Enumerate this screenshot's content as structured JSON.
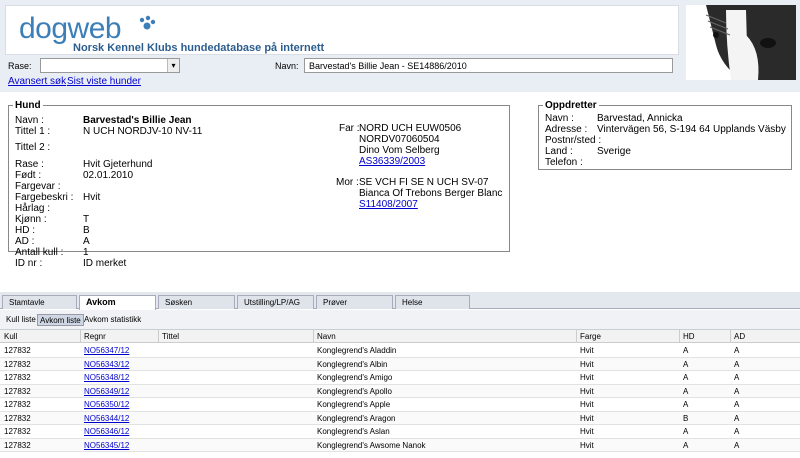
{
  "header": {
    "logo_text": "dogweb",
    "subtitle": "Norsk Kennel Klubs hundedatabase på internett"
  },
  "search": {
    "rase_label": "Rase:",
    "rase_value": "",
    "navn_label": "Navn:",
    "navn_value": "Barvestad's Billie Jean - SE14886/2010",
    "avansert_link": "Avansert søk",
    "sist_link": "Sist viste hunder"
  },
  "hund": {
    "legend": "Hund",
    "fields": [
      {
        "label": "Navn :",
        "value": "Barvestad's Billie Jean"
      },
      {
        "label": "Tittel 1 :",
        "value": "N UCH NORDJV-10 NV-11"
      },
      {
        "label": "Tittel 2 :",
        "value": ""
      },
      {
        "label": "Rase :",
        "value": "Hvit Gjeterhund"
      },
      {
        "label": "Født :",
        "value": "02.01.2010"
      },
      {
        "label": "Fargevar :",
        "value": ""
      },
      {
        "label": "Fargebeskri :",
        "value": "Hvit"
      },
      {
        "label": "Hårlag :",
        "value": ""
      },
      {
        "label": "Kjønn :",
        "value": "T"
      },
      {
        "label": "HD :",
        "value": "B"
      },
      {
        "label": "AD :",
        "value": "A"
      },
      {
        "label": "Antall kull :",
        "value": "1"
      },
      {
        "label": "ID nr :",
        "value": "ID merket"
      }
    ],
    "far": {
      "label": "Far :",
      "titles": "NORD UCH EUW0506",
      "titles2": "NORDV07060504",
      "name": "Dino Vom Selberg",
      "regnr": "AS36339/2003"
    },
    "mor": {
      "label": "Mor :",
      "titles": "SE VCH FI SE N UCH SV-07",
      "name": "Bianca Of Trebons Berger Blanc",
      "regnr": "S11408/2007"
    }
  },
  "oppdretter": {
    "legend": "Oppdretter",
    "fields": [
      {
        "label": "Navn :",
        "value": "Barvestad, Annicka"
      },
      {
        "label": "Adresse :",
        "value": "Vintervägen 56, S-194 64 Upplands Väsby"
      },
      {
        "label": "Postnr/sted :",
        "value": ""
      },
      {
        "label": "Land :",
        "value": "Sverige"
      },
      {
        "label": "Telefon :",
        "value": ""
      }
    ]
  },
  "tabs": [
    "Stamtavle",
    "Avkom",
    "Søsken",
    "Utstilling/LP/AG",
    "Prøver",
    "Helse"
  ],
  "active_tab": "Avkom",
  "subtabs": [
    "Kull liste",
    "Avkom liste",
    "Avkom statistikk"
  ],
  "active_subtab": "Avkom liste",
  "table": {
    "columns": [
      "Kull",
      "Regnr",
      "Tittel",
      "Navn",
      "Farge",
      "HD",
      "AD"
    ],
    "rows": [
      {
        "kull": "127832",
        "regnr": "NO56347/12",
        "tittel": "",
        "navn": "Konglegrend's Aladdin",
        "farge": "Hvit",
        "hd": "A",
        "ad": "A"
      },
      {
        "kull": "127832",
        "regnr": "NO56343/12",
        "tittel": "",
        "navn": "Konglegrend's Albin",
        "farge": "Hvit",
        "hd": "A",
        "ad": "A"
      },
      {
        "kull": "127832",
        "regnr": "NO56348/12",
        "tittel": "",
        "navn": "Konglegrend's Amigo",
        "farge": "Hvit",
        "hd": "A",
        "ad": "A"
      },
      {
        "kull": "127832",
        "regnr": "NO56349/12",
        "tittel": "",
        "navn": "Konglegrend's Apollo",
        "farge": "Hvit",
        "hd": "A",
        "ad": "A"
      },
      {
        "kull": "127832",
        "regnr": "NO56350/12",
        "tittel": "",
        "navn": "Konglegrend's Apple",
        "farge": "Hvit",
        "hd": "A",
        "ad": "A"
      },
      {
        "kull": "127832",
        "regnr": "NO56344/12",
        "tittel": "",
        "navn": "Konglegrend's Aragon",
        "farge": "Hvit",
        "hd": "B",
        "ad": "A"
      },
      {
        "kull": "127832",
        "regnr": "NO56346/12",
        "tittel": "",
        "navn": "Konglegrend's Aslan",
        "farge": "Hvit",
        "hd": "A",
        "ad": "A"
      },
      {
        "kull": "127832",
        "regnr": "NO56345/12",
        "tittel": "",
        "navn": "Konglegrend's Awsome Nanok",
        "farge": "Hvit",
        "hd": "A",
        "ad": "A"
      }
    ]
  },
  "colors": {
    "logo_blue": "#3c7fb8",
    "link": "#0000cc",
    "header_bg": "#e9eef5"
  }
}
